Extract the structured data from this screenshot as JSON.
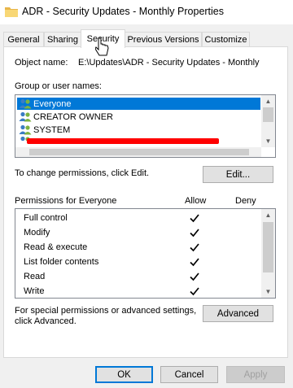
{
  "window": {
    "title": "ADR - Security Updates - Monthly Properties",
    "folder_icon": "folder-icon"
  },
  "tabs": [
    {
      "label": "General"
    },
    {
      "label": "Sharing"
    },
    {
      "label": "Security",
      "active": true
    },
    {
      "label": "Previous Versions"
    },
    {
      "label": "Customize"
    }
  ],
  "security": {
    "object_name_label": "Object name:",
    "object_name_value": "E:\\Updates\\ADR - Security Updates - Monthly",
    "group_label": "Group or user names:",
    "users": [
      {
        "name": "Everyone",
        "icon": "users-icon",
        "selected": true
      },
      {
        "name": "CREATOR OWNER",
        "icon": "users-icon"
      },
      {
        "name": "SYSTEM",
        "icon": "users-icon"
      },
      {
        "name": "",
        "icon": "users-icon",
        "redacted": true
      }
    ],
    "change_text": "To change permissions, click Edit.",
    "edit_button": "Edit...",
    "permissions_label": "Permissions for Everyone",
    "allow_header": "Allow",
    "deny_header": "Deny",
    "permissions": [
      {
        "name": "Full control",
        "allow": true,
        "deny": false
      },
      {
        "name": "Modify",
        "allow": true,
        "deny": false
      },
      {
        "name": "Read & execute",
        "allow": true,
        "deny": false
      },
      {
        "name": "List folder contents",
        "allow": true,
        "deny": false
      },
      {
        "name": "Read",
        "allow": true,
        "deny": false
      },
      {
        "name": "Write",
        "allow": true,
        "deny": false
      }
    ],
    "special_text_1": "For special permissions or advanced settings,",
    "special_text_2": "click Advanced.",
    "advanced_button": "Advanced"
  },
  "footer": {
    "ok": "OK",
    "cancel": "Cancel",
    "apply": "Apply"
  },
  "colors": {
    "selection": "#0078d7",
    "redaction": "#ff0000"
  }
}
